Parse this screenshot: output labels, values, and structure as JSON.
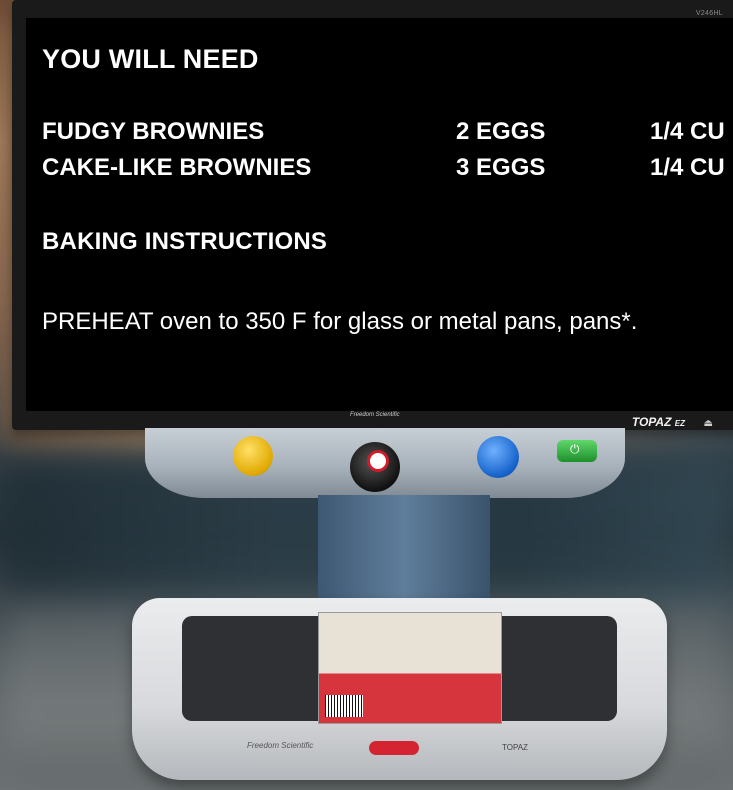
{
  "screen": {
    "heading1": "YOU WILL NEED",
    "rows": [
      {
        "item": "FUDGY BROWNIES",
        "eggs": "2 EGGS",
        "cup": "1/4 CU"
      },
      {
        "item": "CAKE-LIKE BROWNIES",
        "eggs": "3 EGGS",
        "cup": "1/4 CU"
      }
    ],
    "heading2": "BAKING INSTRUCTIONS",
    "paragraph": "PREHEAT oven to 350 F for glass or metal pans, pans*."
  },
  "device": {
    "monitor_model": "V246HL",
    "bezel_brand": "Freedom Scientific",
    "bezel_model": "TOPAZ",
    "bezel_model_suffix": "EZ",
    "base_brand": "Freedom Scientific",
    "base_model": "TOPAZ"
  },
  "colors": {
    "knob_yellow": "#e0a800",
    "knob_red_ring": "#d01b2b",
    "knob_blue": "#1462c9",
    "power_button": "#1e8f2c",
    "release_button": "#d52431"
  },
  "icons": [
    "eject-icon",
    "power-icon"
  ]
}
